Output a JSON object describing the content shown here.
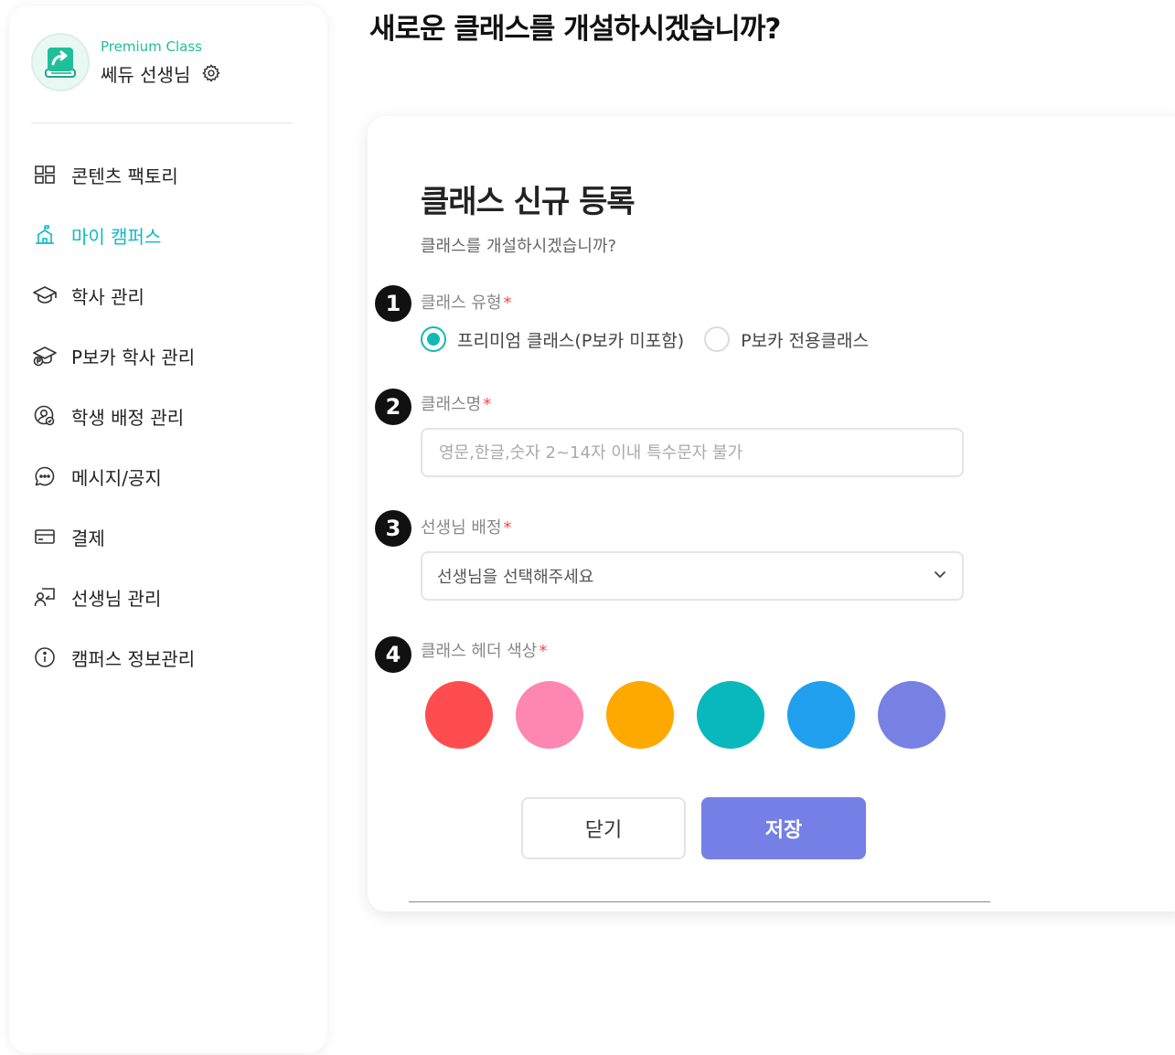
{
  "page": {
    "title": "새로운 클래스를 개설하시겠습니까?"
  },
  "profile": {
    "class_label": "Premium Class",
    "name": "쎄듀 선생님"
  },
  "sidebar": {
    "items": [
      {
        "label": "콘텐츠 팩토리",
        "icon": "content-factory-icon",
        "active": false
      },
      {
        "label": "마이 캠퍼스",
        "icon": "campus-icon",
        "active": true
      },
      {
        "label": "학사 관리",
        "icon": "graduation-cap-icon",
        "active": false
      },
      {
        "label": "P보카 학사 관리",
        "icon": "pvoca-cap-icon",
        "active": false
      },
      {
        "label": "학생 배정 관리",
        "icon": "student-assign-icon",
        "active": false
      },
      {
        "label": "메시지/공지",
        "icon": "message-icon",
        "active": false
      },
      {
        "label": "결제",
        "icon": "card-icon",
        "active": false
      },
      {
        "label": "선생님 관리",
        "icon": "teacher-icon",
        "active": false
      },
      {
        "label": "캠퍼스 정보관리",
        "icon": "info-icon",
        "active": false
      }
    ]
  },
  "form": {
    "title": "클래스 신규 등록",
    "subtitle": "클래스를 개설하시겠습니까?",
    "required_mark": "*",
    "steps": [
      "1",
      "2",
      "3",
      "4"
    ],
    "class_type": {
      "label": "클래스 유형",
      "options": [
        {
          "label": "프리미엄 클래스(P보카 미포함)",
          "checked": true
        },
        {
          "label": "P보카 전용클래스",
          "checked": false
        }
      ]
    },
    "class_name": {
      "label": "클래스명",
      "value": "",
      "placeholder": "영문,한글,숫자 2~14자 이내 특수문자 불가"
    },
    "teacher": {
      "label": "선생님 배정",
      "selected": "선생님을 선택해주세요"
    },
    "header_color": {
      "label": "클래스 헤더 색상",
      "colors": [
        "#ff4d4f",
        "#fe86b2",
        "#ffa800",
        "#09b8bd",
        "#20a0ee",
        "#7780e3"
      ]
    },
    "buttons": {
      "close": "닫기",
      "save": "저장"
    }
  },
  "colors": {
    "accent": "#10b8c2",
    "brand_green": "#1fbf9a",
    "save_button": "#7480e6",
    "required": "#f04c4c"
  }
}
